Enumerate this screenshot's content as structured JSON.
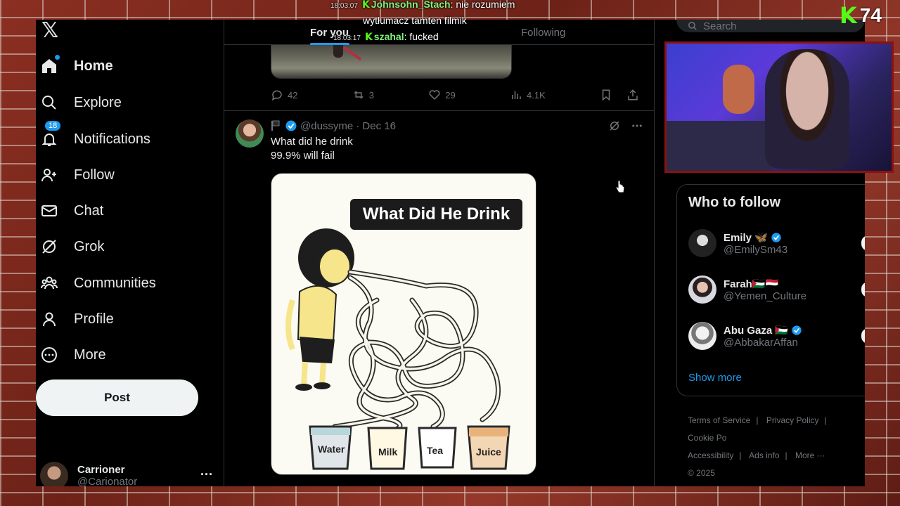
{
  "stream": {
    "viewer_count": "74",
    "chat": [
      {
        "time": "18:03:07",
        "user": "Johnsohn_Stach",
        "message": "nie rozumiem"
      },
      {
        "time": "",
        "user": "",
        "message": "wytłumacz tamten filmik"
      },
      {
        "time": "18:03:17",
        "user": "szahal",
        "message": "fucked"
      }
    ]
  },
  "nav": {
    "items": [
      {
        "label": "Home",
        "icon": "home-icon"
      },
      {
        "label": "Explore",
        "icon": "search-icon"
      },
      {
        "label": "Notifications",
        "icon": "bell-icon",
        "badge": "18"
      },
      {
        "label": "Follow",
        "icon": "add-user-icon"
      },
      {
        "label": "Chat",
        "icon": "envelope-icon"
      },
      {
        "label": "Grok",
        "icon": "grok-icon"
      },
      {
        "label": "Communities",
        "icon": "communities-icon"
      },
      {
        "label": "Profile",
        "icon": "user-icon"
      },
      {
        "label": "More",
        "icon": "more-circle-icon"
      }
    ],
    "post_label": "Post",
    "account": {
      "name": "Carrioner",
      "handle": "@Carionator"
    }
  },
  "timeline": {
    "tabs": [
      {
        "label": "For you",
        "active": true
      },
      {
        "label": "Following",
        "active": false
      }
    ],
    "prev_tweet_actions": {
      "replies": "42",
      "reposts": "3",
      "likes": "29",
      "views": "4.1K"
    },
    "tweet": {
      "handle": "@dussyme",
      "date": "· Dec 16",
      "text_line1": "What did he drink",
      "text_line2": "99.9% will fail",
      "image": {
        "title": "What Did He Drink",
        "cups": [
          "Water",
          "Milk",
          "Tea",
          "Juice"
        ]
      }
    }
  },
  "sidebar": {
    "search_placeholder": "Search",
    "who_to_follow_title": "Who to follow",
    "suggestions": [
      {
        "name": "Emily 🦋",
        "handle": "@EmilySm43",
        "verified": true
      },
      {
        "name": "Farah🇵🇸🇾🇪",
        "handle": "@Yemen_Culture",
        "verified": false
      },
      {
        "name": "Abu Gaza 🇵🇸",
        "handle": "@AbbakarAffan",
        "verified": true
      }
    ],
    "show_more": "Show more",
    "footer_links": [
      "Terms of Service",
      "|",
      "Privacy Policy",
      "|",
      "Cookie Po",
      "Accessibility",
      "|",
      "Ads info",
      "|",
      "More ···",
      "© 2025"
    ]
  },
  "colors": {
    "accent": "#1d9bf0",
    "kick_green": "#53fc18",
    "background": "#000000"
  }
}
